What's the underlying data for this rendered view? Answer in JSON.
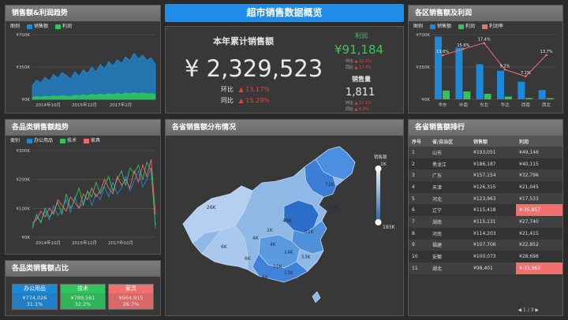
{
  "header": {
    "title": "超市销售数据概览"
  },
  "sales_profit_trend": {
    "title": "销售额&利润趋势",
    "legend_label": "图例",
    "legend": [
      "销售额",
      "利润"
    ],
    "colors": [
      "#1e88d8",
      "#2fc45e"
    ],
    "y_ticks": [
      "¥700K",
      "¥350K",
      "¥0K"
    ],
    "x_ticks": [
      "2014年10月",
      "2015年12月",
      "2017年2月"
    ]
  },
  "kpi": {
    "title": "本年累计销售额",
    "value": "¥ 2,329,523",
    "yoy_ring_label": "环比",
    "ring_value": "13.17%",
    "yoy_label": "同比",
    "yoy_value": "15.29%",
    "profit_title": "利润",
    "profit_value": "¥91,184",
    "profit_ring_label": "环比",
    "profit_ring_value": "22.1%",
    "profit_yoy_label": "同比",
    "profit_yoy_value": "17.4%",
    "qty_title": "销售量",
    "qty_value": "1,811",
    "qty_ring_label": "环比",
    "qty_ring_value": "21.1%",
    "qty_yoy_label": "同比",
    "qty_yoy_value": "6.8%",
    "up_color": "#e0483e",
    "profit_color": "#3fc45c"
  },
  "region": {
    "title": "各区销售额及利润",
    "legend_label": "图例",
    "legend": [
      "销售额",
      "利润",
      "利润率"
    ],
    "y_ticks": [
      "¥700K",
      "¥350K",
      "¥0K"
    ],
    "categories": [
      "华东",
      "中南",
      "东北",
      "华北",
      "西南",
      "西北"
    ],
    "rate_labels": [
      "13.6%",
      "15.6%",
      "17.4%",
      "9.2%",
      "7.1%",
      "13.7%"
    ]
  },
  "category_trend": {
    "title": "各品类销售额趋势",
    "legend_label": "类别",
    "legend": [
      "办公用品",
      "技术",
      "家具"
    ],
    "colors": [
      "#1e88d8",
      "#2fc45e",
      "#f06a6a"
    ],
    "y_ticks": [
      "¥300K",
      "¥200K",
      "¥100K",
      "¥0K"
    ],
    "x_ticks": [
      "2014年10月",
      "2015年12月",
      "2017年02月"
    ]
  },
  "map": {
    "title": "各省销售额分布情况",
    "scale_title": "销售额",
    "scale_max": "1K",
    "scale_min": "193K",
    "labels": [
      "26K",
      "6K",
      "72K",
      "73K",
      "40K",
      "1K",
      "4K",
      "31K",
      "4K",
      "6K",
      "14K",
      "11K",
      "53K",
      "13K",
      "6K"
    ]
  },
  "category_share": {
    "title": "各品类销售额占比",
    "items": [
      {
        "name": "办公用品",
        "value": "¥774,026",
        "pct": "31.1%",
        "color": "#1e88d8"
      },
      {
        "name": "技术",
        "value": "¥789,581",
        "pct": "32.2%",
        "color": "#2fc45e"
      },
      {
        "name": "家具",
        "value": "¥664,915",
        "pct": "26.7%",
        "color": "#f07070"
      }
    ]
  },
  "ranking": {
    "title": "各省销售额排行",
    "columns": [
      "序号",
      "省/自治区",
      "销售额",
      "利润"
    ],
    "rows": [
      [
        "1",
        "山东",
        "¥193,051",
        "¥49,146"
      ],
      [
        "2",
        "黑龙江",
        "¥186,187",
        "¥40,115"
      ],
      [
        "3",
        "广东",
        "¥157,154",
        "¥32,796"
      ],
      [
        "4",
        "天津",
        "¥126,315",
        "¥21,045"
      ],
      [
        "5",
        "河北",
        "¥123,963",
        "¥17,533"
      ],
      [
        "6",
        "辽宁",
        "¥115,418",
        "¥-35,857"
      ],
      [
        "7",
        "湖南",
        "¥115,131",
        "¥27,740"
      ],
      [
        "8",
        "河南",
        "¥114,203",
        "¥21,415"
      ],
      [
        "9",
        "福建",
        "¥107,706",
        "¥22,852"
      ],
      [
        "10",
        "安徽",
        "¥100,073",
        "¥28,696"
      ],
      [
        "11",
        "湖北",
        "¥98,401",
        "¥-33,963"
      ]
    ],
    "negative_rows": [
      5,
      10
    ],
    "pager": "◀ 1 / 3 ▶"
  },
  "chart_data": [
    {
      "type": "area",
      "title": "销售额&利润趋势",
      "x": [
        "2014年10月",
        "2015年12月",
        "2017年2月"
      ],
      "series": [
        {
          "name": "销售额",
          "values": [
            150,
            210,
            180,
            240,
            200,
            270,
            230,
            290,
            260,
            220,
            300,
            250,
            320,
            280,
            350,
            300,
            380,
            330,
            410,
            360,
            430,
            390,
            460,
            420,
            500,
            440,
            480,
            420,
            450,
            380
          ]
        },
        {
          "name": "利润",
          "values": [
            20,
            30,
            25,
            35,
            28,
            40,
            32,
            42,
            36,
            30,
            45,
            38,
            50,
            40,
            55,
            45,
            58,
            48,
            62,
            52,
            65,
            55,
            70,
            60,
            72,
            62,
            68,
            58,
            64,
            54
          ]
        }
      ],
      "ylim": [
        0,
        700
      ]
    },
    {
      "type": "bar",
      "title": "各区销售额及利润",
      "categories": [
        "华东",
        "中南",
        "东北",
        "华北",
        "西南",
        "西北"
      ],
      "series": [
        {
          "name": "销售额",
          "values": [
            680,
            560,
            380,
            310,
            190,
            100
          ]
        },
        {
          "name": "利润",
          "values": [
            95,
            85,
            60,
            30,
            14,
            13
          ]
        },
        {
          "name": "利润率",
          "values": [
            13.6,
            15.6,
            17.4,
            9.2,
            7.1,
            13.7
          ]
        }
      ],
      "ylim": [
        0,
        700
      ]
    },
    {
      "type": "line",
      "title": "各品类销售额趋势",
      "x": [
        "2014年10月",
        "2015年12月",
        "2017年02月"
      ],
      "series": [
        {
          "name": "办公用品",
          "values": [
            40,
            70,
            55,
            90,
            60,
            110,
            75,
            95,
            130,
            85,
            140,
            100,
            120,
            160,
            110,
            150,
            130,
            175,
            140,
            190,
            150,
            170,
            210,
            160,
            195,
            230,
            175,
            200,
            240,
            30
          ]
        },
        {
          "name": "技术",
          "values": [
            30,
            80,
            50,
            100,
            70,
            90,
            120,
            80,
            150,
            100,
            130,
            170,
            110,
            160,
            140,
            190,
            150,
            180,
            210,
            160,
            200,
            230,
            180,
            240,
            220,
            250,
            200,
            260,
            230,
            40
          ]
        },
        {
          "name": "家具",
          "values": [
            50,
            60,
            90,
            70,
            100,
            80,
            130,
            110,
            90,
            140,
            120,
            100,
            150,
            130,
            170,
            140,
            160,
            200,
            170,
            150,
            210,
            180,
            200,
            170,
            230,
            190,
            250,
            210,
            270,
            80
          ]
        }
      ],
      "ylim": [
        0,
        300
      ]
    }
  ]
}
